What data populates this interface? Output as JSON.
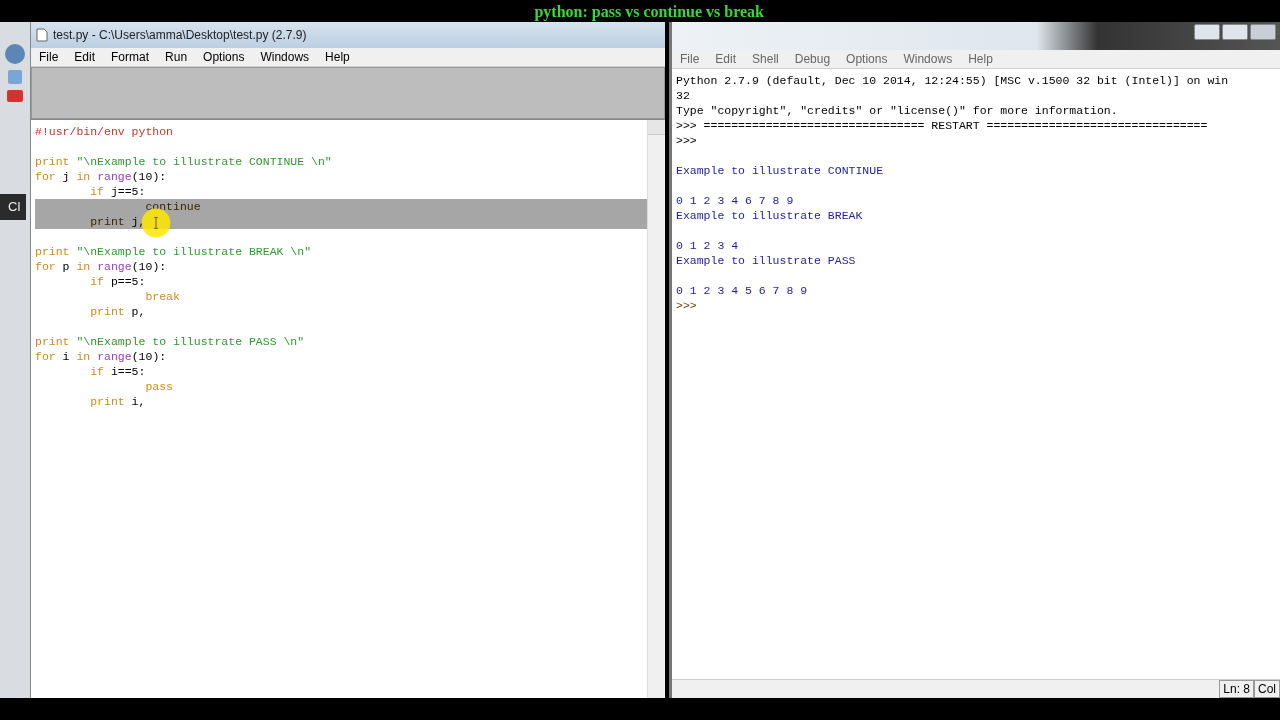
{
  "desktop": {
    "tooltip": "Cl"
  },
  "banner": {
    "text": "python: pass vs continue vs break"
  },
  "editor": {
    "title": "test.py - C:\\Users\\amma\\Desktop\\test.py (2.7.9)",
    "menu": [
      "File",
      "Edit",
      "Format",
      "Run",
      "Options",
      "Windows",
      "Help"
    ],
    "lines": [
      {
        "selected": false,
        "tokens": [
          {
            "kind": "comment",
            "text": "#!usr/bin/env python"
          }
        ]
      },
      {
        "selected": false
      },
      {
        "selected": false,
        "tokens": [
          {
            "kind": "keyword",
            "text": "print"
          },
          {
            "kind": "string",
            "text": " \"\\nExample to illustrate CONTINUE \\n\""
          }
        ]
      },
      {
        "selected": false,
        "tokens": [
          {
            "kind": "keyword",
            "text": "for"
          },
          {
            "kind": "plain",
            "text": " j "
          },
          {
            "kind": "keyword",
            "text": "in"
          },
          {
            "kind": "builtin",
            "text": " range"
          },
          {
            "kind": "plain",
            "text": "(10):"
          }
        ]
      },
      {
        "selected": false,
        "tokens": [
          {
            "kind": "keyword",
            "text": "        if"
          },
          {
            "kind": "plain",
            "text": " j==5:"
          }
        ]
      },
      {
        "selected": true,
        "tokens": [
          {
            "kind": "keyword",
            "text": "                continue"
          }
        ]
      },
      {
        "selected": true,
        "tokens": [
          {
            "kind": "keyword",
            "text": "        print"
          },
          {
            "kind": "plain",
            "text": " j,"
          }
        ]
      },
      {
        "selected": false
      },
      {
        "selected": false,
        "tokens": [
          {
            "kind": "keyword",
            "text": "print"
          },
          {
            "kind": "string",
            "text": " \"\\nExample to illustrate BREAK \\n\""
          }
        ]
      },
      {
        "selected": false,
        "tokens": [
          {
            "kind": "keyword",
            "text": "for"
          },
          {
            "kind": "plain",
            "text": " p "
          },
          {
            "kind": "keyword",
            "text": "in"
          },
          {
            "kind": "builtin",
            "text": " range"
          },
          {
            "kind": "plain",
            "text": "(10):"
          }
        ]
      },
      {
        "selected": false,
        "tokens": [
          {
            "kind": "keyword",
            "text": "        if"
          },
          {
            "kind": "plain",
            "text": " p==5:"
          }
        ]
      },
      {
        "selected": false,
        "tokens": [
          {
            "kind": "keyword",
            "text": "                break"
          }
        ]
      },
      {
        "selected": false,
        "tokens": [
          {
            "kind": "keyword",
            "text": "        print"
          },
          {
            "kind": "plain",
            "text": " p,"
          }
        ]
      },
      {
        "selected": false
      },
      {
        "selected": false,
        "tokens": [
          {
            "kind": "keyword",
            "text": "print"
          },
          {
            "kind": "string",
            "text": " \"\\nExample to illustrate PASS \\n\""
          }
        ]
      },
      {
        "selected": false,
        "tokens": [
          {
            "kind": "keyword",
            "text": "for"
          },
          {
            "kind": "plain",
            "text": " i "
          },
          {
            "kind": "keyword",
            "text": "in"
          },
          {
            "kind": "builtin",
            "text": " range"
          },
          {
            "kind": "plain",
            "text": "(10):"
          }
        ]
      },
      {
        "selected": false,
        "tokens": [
          {
            "kind": "keyword",
            "text": "        if"
          },
          {
            "kind": "plain",
            "text": " i==5:"
          }
        ]
      },
      {
        "selected": false,
        "tokens": [
          {
            "kind": "keyword",
            "text": "                pass"
          }
        ]
      },
      {
        "selected": false,
        "tokens": [
          {
            "kind": "keyword",
            "text": "        print"
          },
          {
            "kind": "plain",
            "text": " i,"
          }
        ]
      }
    ]
  },
  "shell": {
    "menu": [
      "File",
      "Edit",
      "Shell",
      "Debug",
      "Options",
      "Windows",
      "Help"
    ],
    "lines": [
      {
        "kind": "info",
        "text": "Python 2.7.9 (default, Dec 10 2014, 12:24:55) [MSC v.1500 32 bit (Intel)] on win"
      },
      {
        "kind": "info",
        "text": "32"
      },
      {
        "kind": "info",
        "text": "Type \"copyright\", \"credits\" or \"license()\" for more information."
      },
      {
        "kind": "info",
        "text": ">>> ================================ RESTART ================================"
      },
      {
        "kind": "info",
        "text": ">>>"
      },
      {
        "kind": "blank"
      },
      {
        "kind": "output",
        "text": "Example to illustrate CONTINUE"
      },
      {
        "kind": "blank"
      },
      {
        "kind": "output",
        "text": "0 1 2 3 4 6 7 8 9"
      },
      {
        "kind": "output",
        "text": "Example to illustrate BREAK"
      },
      {
        "kind": "blank"
      },
      {
        "kind": "output",
        "text": "0 1 2 3 4"
      },
      {
        "kind": "output",
        "text": "Example to illustrate PASS"
      },
      {
        "kind": "blank"
      },
      {
        "kind": "output",
        "text": "0 1 2 3 4 5 6 7 8 9"
      },
      {
        "kind": "prompt",
        "text": ">>>"
      }
    ],
    "status": [
      "Ln: 8",
      "Col"
    ]
  }
}
